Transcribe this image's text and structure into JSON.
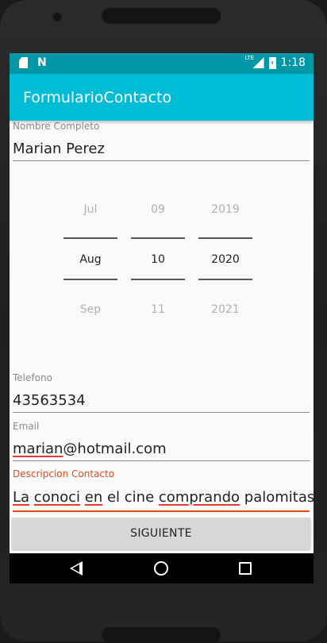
{
  "status_bar": {
    "network_label": "LTE",
    "time": "1:18",
    "icons": [
      "sd-card-icon",
      "n-notification-icon",
      "signal-icon",
      "battery-charging-icon"
    ]
  },
  "app_bar": {
    "title": "FormularioContacto"
  },
  "form": {
    "nombre": {
      "label": "Nombre Completo",
      "value": "Marian Perez"
    },
    "date_picker": {
      "month": {
        "prev": "Jul",
        "selected": "Aug",
        "next": "Sep"
      },
      "day": {
        "prev": "09",
        "selected": "10",
        "next": "11"
      },
      "year": {
        "prev": "2019",
        "selected": "2020",
        "next": "2021"
      }
    },
    "telefono": {
      "label": "Telefono",
      "value": "43563534"
    },
    "email": {
      "label": "Email",
      "value_part1": "marian",
      "value_part2": "@hotmail.com"
    },
    "descripcion": {
      "label": "Descripcion Contacto",
      "words": [
        "La",
        "conoci",
        "en",
        "el cine",
        "comprando",
        "palomitas"
      ]
    },
    "submit_label": "SIGUIENTE"
  },
  "colors": {
    "status_bar": "#0097a7",
    "app_bar": "#00bcd4",
    "active_accent": "#e64a19",
    "spellcheck": "#e53935",
    "button_bg": "#d6d7d7"
  },
  "nav_bar": {
    "icons": [
      "back-icon",
      "home-icon",
      "recents-icon"
    ]
  }
}
